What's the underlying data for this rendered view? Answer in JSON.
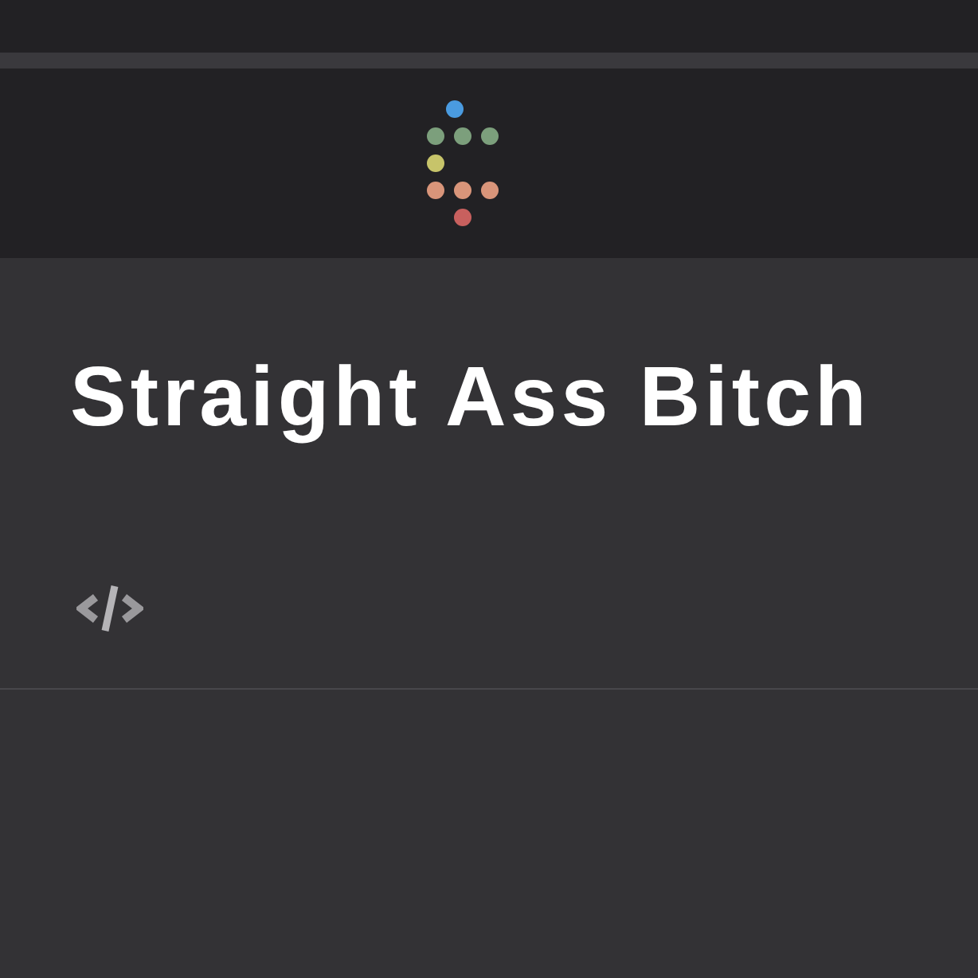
{
  "title": "Straight Ass Bitch"
}
